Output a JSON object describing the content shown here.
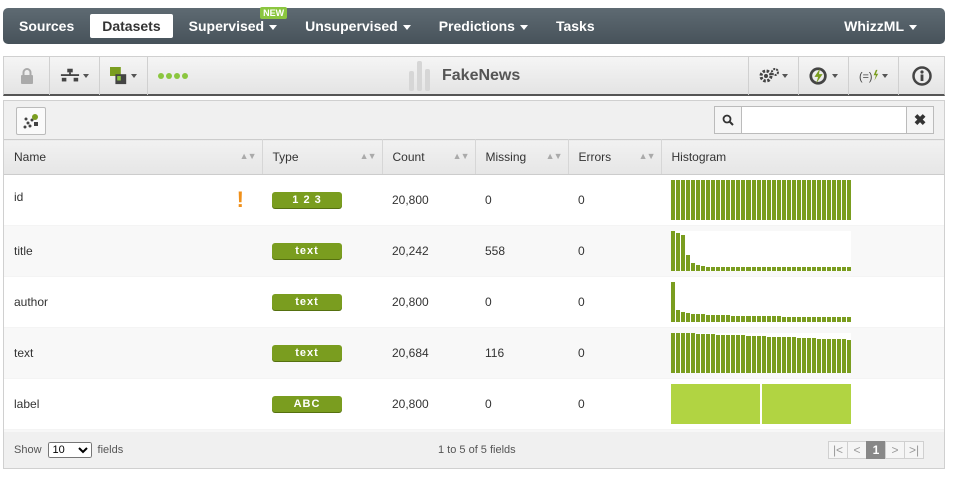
{
  "nav": {
    "items": [
      {
        "label": "Sources",
        "active": false,
        "caret": false
      },
      {
        "label": "Datasets",
        "active": true,
        "caret": false
      },
      {
        "label": "Supervised",
        "active": false,
        "caret": true,
        "badge": "NEW"
      },
      {
        "label": "Unsupervised",
        "active": false,
        "caret": true
      },
      {
        "label": "Predictions",
        "active": false,
        "caret": true
      },
      {
        "label": "Tasks",
        "active": false,
        "caret": false
      }
    ],
    "right_label": "WhizzML"
  },
  "toolbar": {
    "dataset_name": "FakeNews",
    "icons": [
      "lock-icon",
      "model-tree-icon",
      "sample-dataset-icon",
      "status-dots-icon",
      "settings-icon",
      "one-click-icon",
      "formula-icon",
      "info-icon"
    ]
  },
  "search": {
    "placeholder": "",
    "clear_label": "✖"
  },
  "table": {
    "columns": [
      "Name",
      "Type",
      "Count",
      "Missing",
      "Errors",
      "Histogram"
    ],
    "rows": [
      {
        "name": "id",
        "warning": "!",
        "type": "1 2 3",
        "count": "20,800",
        "missing": "0",
        "errors": "0",
        "hist": [
          1,
          1,
          1,
          1,
          1,
          1,
          1,
          1,
          1,
          1,
          1,
          1,
          1,
          1,
          1,
          1,
          1,
          1,
          1,
          1,
          1,
          1,
          1,
          1,
          1,
          1,
          1,
          1,
          1,
          1,
          1,
          1,
          1,
          1,
          1,
          1
        ],
        "hist_kind": "numeric"
      },
      {
        "name": "title",
        "warning": "",
        "type": "text",
        "count": "20,242",
        "missing": "558",
        "errors": "0",
        "hist": [
          1,
          0.95,
          0.9,
          0.4,
          0.2,
          0.15,
          0.12,
          0.11,
          0.1,
          0.1,
          0.1,
          0.1,
          0.1,
          0.1,
          0.1,
          0.1,
          0.1,
          0.1,
          0.1,
          0.1,
          0.1,
          0.1,
          0.1,
          0.1,
          0.1,
          0.1,
          0.1,
          0.1,
          0.1,
          0.1,
          0.1,
          0.1,
          0.1,
          0.1,
          0.1,
          0.1
        ],
        "hist_kind": "numeric"
      },
      {
        "name": "author",
        "warning": "",
        "type": "text",
        "count": "20,800",
        "missing": "0",
        "errors": "0",
        "hist": [
          1,
          0.3,
          0.25,
          0.22,
          0.2,
          0.2,
          0.2,
          0.18,
          0.18,
          0.18,
          0.17,
          0.17,
          0.16,
          0.16,
          0.15,
          0.15,
          0.15,
          0.15,
          0.14,
          0.14,
          0.14,
          0.14,
          0.13,
          0.13,
          0.13,
          0.13,
          0.13,
          0.12,
          0.12,
          0.12,
          0.12,
          0.12,
          0.12,
          0.12,
          0.12,
          0.12
        ],
        "hist_kind": "numeric"
      },
      {
        "name": "text",
        "warning": "",
        "type": "text",
        "count": "20,684",
        "missing": "116",
        "errors": "0",
        "hist": [
          1,
          1,
          1,
          0.99,
          0.99,
          0.98,
          0.98,
          0.97,
          0.97,
          0.96,
          0.96,
          0.95,
          0.95,
          0.94,
          0.94,
          0.93,
          0.93,
          0.92,
          0.92,
          0.91,
          0.91,
          0.9,
          0.9,
          0.89,
          0.89,
          0.88,
          0.88,
          0.87,
          0.87,
          0.86,
          0.86,
          0.85,
          0.85,
          0.84,
          0.84,
          0.83
        ],
        "hist_kind": "numeric"
      },
      {
        "name": "label",
        "warning": "",
        "type": "ABC",
        "count": "20,800",
        "missing": "0",
        "errors": "0",
        "hist": [
          1,
          1
        ],
        "hist_kind": "categorical"
      }
    ]
  },
  "footer": {
    "show_label": "Show",
    "page_size": "10",
    "fields_label": "fields",
    "info": "1 to 5 of 5 fields",
    "current_page": "1"
  }
}
